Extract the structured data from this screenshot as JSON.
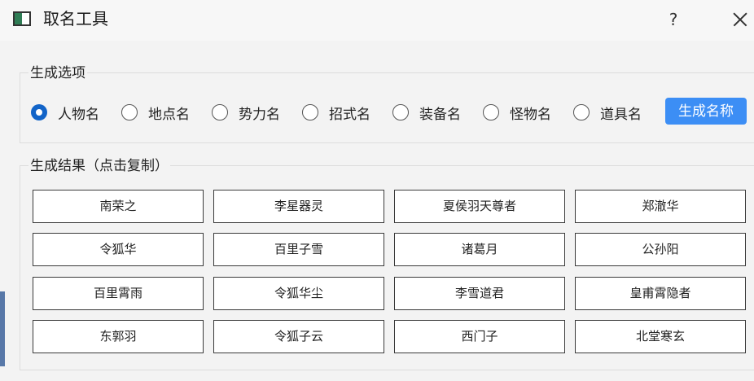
{
  "window": {
    "title": "取名工具",
    "help_label": "?"
  },
  "options": {
    "group_title": "生成选项",
    "radios": [
      {
        "label": "人物名",
        "checked": true
      },
      {
        "label": "地点名",
        "checked": false
      },
      {
        "label": "势力名",
        "checked": false
      },
      {
        "label": "招式名",
        "checked": false
      },
      {
        "label": "装备名",
        "checked": false
      },
      {
        "label": "怪物名",
        "checked": false
      },
      {
        "label": "道具名",
        "checked": false
      }
    ],
    "generate_button": "生成名称"
  },
  "results": {
    "group_title": "生成结果（点击复制）",
    "rows": [
      [
        "南荣之",
        "李星器灵",
        "夏侯羽天尊者",
        "郑澈华"
      ],
      [
        "令狐华",
        "百里子雪",
        "诸葛月",
        "公孙阳"
      ],
      [
        "百里霄雨",
        "令狐华尘",
        "李雪道君",
        "皇甫霄隐者"
      ],
      [
        "东郭羽",
        "令狐子云",
        "西门子",
        "北堂寒玄"
      ]
    ]
  },
  "colors": {
    "accent": "#3c8ef5",
    "radio_checked": "#1264c8"
  }
}
